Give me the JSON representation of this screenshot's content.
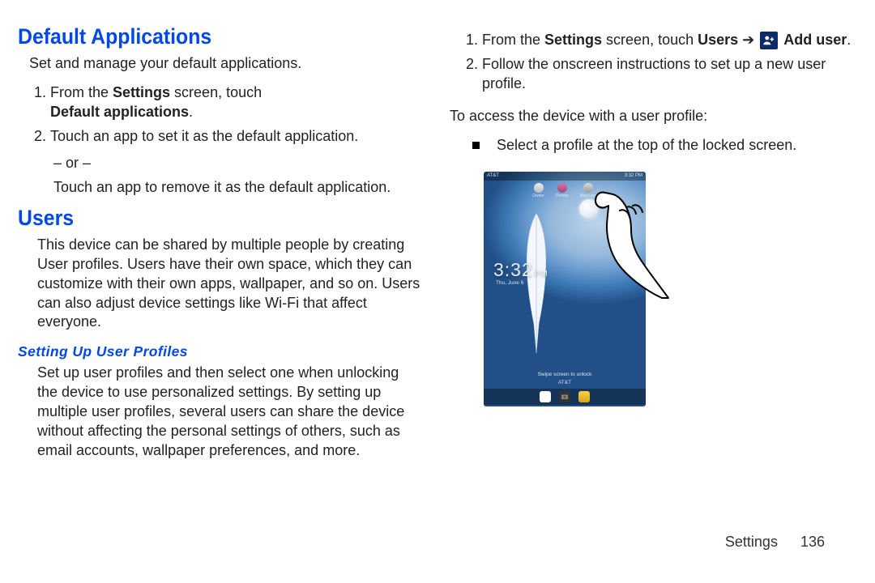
{
  "left": {
    "h_default_apps": "Default Applications",
    "default_apps_intro": "Set and manage your default applications.",
    "step1_prefix": "From the ",
    "step1_bold1": "Settings",
    "step1_mid": " screen, touch ",
    "step1_bold2": "Default applications",
    "step1_end": ".",
    "step2": "Touch an app to set it as the default application.",
    "or": "– or –",
    "step2_alt": "Touch an app to remove it as the default application.",
    "h_users": "Users",
    "users_intro": "This device can be shared by multiple people by creating User profiles. Users have their own space, which they can customize with their own apps, wallpaper, and so on. Users can also adjust device settings like Wi-Fi that affect everyone.",
    "h_setup_profiles": "Setting Up User Profiles",
    "setup_intro": "Set up user profiles and then select one when unlocking the device to use personalized settings. By setting up multiple user profiles, several users can share the device without affecting the personal settings of others, such as email accounts, wallpaper preferences, and more."
  },
  "right": {
    "step1_prefix": "From the ",
    "step1_bold1": "Settings",
    "step1_mid": " screen, touch ",
    "step1_bold2": "Users",
    "step1_arrow": " ➔ ",
    "step1_bold3": "Add user",
    "step1_end": ".",
    "step2": "Follow the onscreen instructions to set up a new user profile.",
    "access_line": "To access the device with a user profile:",
    "bullet1": "Select a profile at the top of the locked screen.",
    "shot": {
      "status_left": "AT&T",
      "status_right": "3:32 PM",
      "profile_owner": "Owner",
      "profile_person": "Person",
      "profile_new": "New user",
      "clock": "3:32",
      "ampm": "PM",
      "date": "Thu, June 6",
      "swipe": "Swipe screen to unlock",
      "carrier": "AT&T",
      "dock_g": "g"
    }
  },
  "footer": {
    "section": "Settings",
    "page": "136"
  }
}
